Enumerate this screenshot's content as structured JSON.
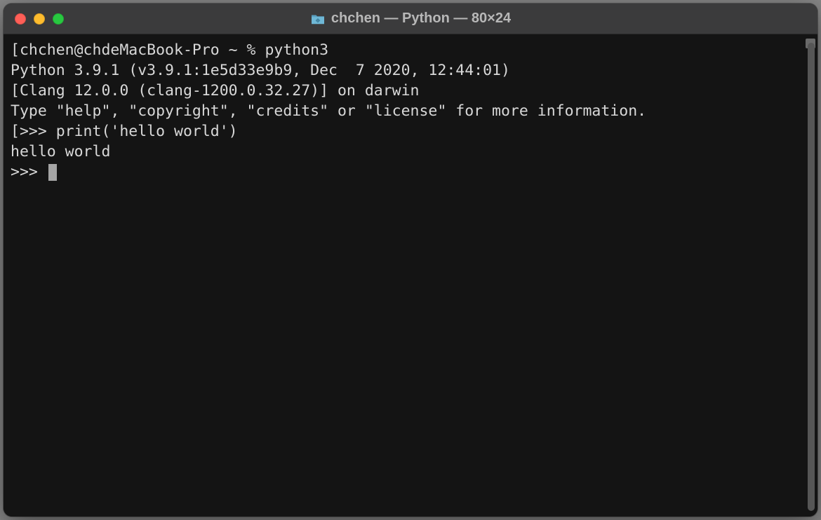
{
  "window": {
    "title": "chchen — Python — 80×24"
  },
  "terminal": {
    "lines": [
      "chchen@chdeMacBook-Pro ~ % python3",
      "Python 3.9.1 (v3.9.1:1e5d33e9b9, Dec  7 2020, 12:44:01)",
      "[Clang 12.0.0 (clang-1200.0.32.27)] on darwin",
      "Type \"help\", \"copyright\", \"credits\" or \"license\" for more information.",
      ">>> print('hello world')",
      "hello world",
      ">>> "
    ],
    "bracket_open": "[",
    "bracket_close": "]"
  }
}
